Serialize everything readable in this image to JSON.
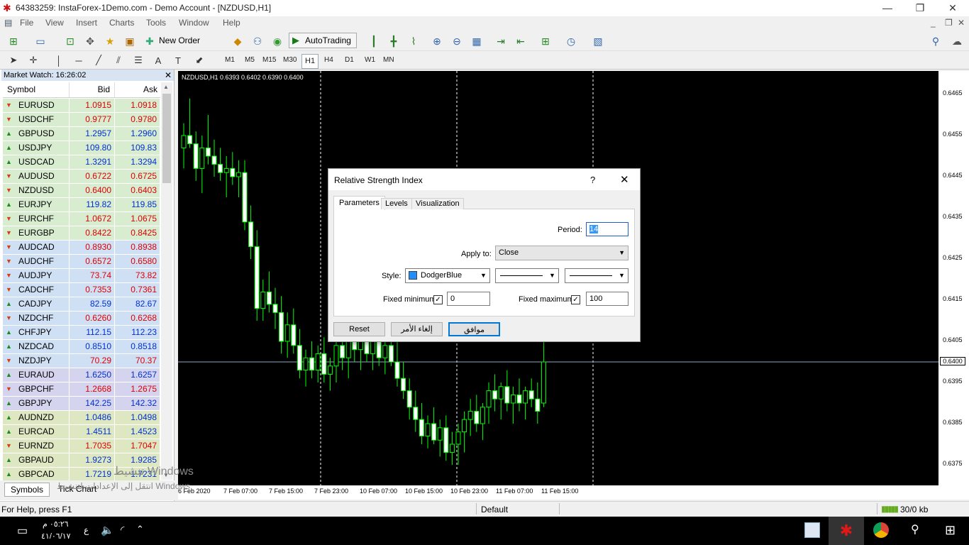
{
  "window": {
    "title": "64383259: InstaForex-1Demo.com - Demo Account - [NZDUSD,H1]",
    "minimize": "—",
    "restore": "❐",
    "close": "✕"
  },
  "menu": {
    "items": [
      "File",
      "View",
      "Insert",
      "Charts",
      "Tools",
      "Window",
      "Help"
    ]
  },
  "toolbar": {
    "new_order": "New Order",
    "autotrading": "AutoTrading"
  },
  "timeframes": [
    "M1",
    "M5",
    "M15",
    "M30",
    "H1",
    "H4",
    "D1",
    "W1",
    "MN"
  ],
  "selected_timeframe": "H1",
  "market_watch": {
    "title": "Market Watch: 16:26:02",
    "columns": [
      "Symbol",
      "Bid",
      "Ask"
    ],
    "rows": [
      {
        "symbol": "EURUSD",
        "bid": "1.0915",
        "ask": "1.0918",
        "dir": "dn",
        "bidc": "red",
        "askc": "red",
        "bg": "#d8ecd0"
      },
      {
        "symbol": "USDCHF",
        "bid": "0.9777",
        "ask": "0.9780",
        "dir": "dn",
        "bidc": "red",
        "askc": "red",
        "bg": "#d8ecd0"
      },
      {
        "symbol": "GBPUSD",
        "bid": "1.2957",
        "ask": "1.2960",
        "dir": "up",
        "bidc": "blue",
        "askc": "blue",
        "bg": "#d8ecd0"
      },
      {
        "symbol": "USDJPY",
        "bid": "109.80",
        "ask": "109.83",
        "dir": "up",
        "bidc": "blue",
        "askc": "blue",
        "bg": "#d8ecd0"
      },
      {
        "symbol": "USDCAD",
        "bid": "1.3291",
        "ask": "1.3294",
        "dir": "up",
        "bidc": "blue",
        "askc": "blue",
        "bg": "#d8ecd0"
      },
      {
        "symbol": "AUDUSD",
        "bid": "0.6722",
        "ask": "0.6725",
        "dir": "dn",
        "bidc": "red",
        "askc": "red",
        "bg": "#d8ecd0"
      },
      {
        "symbol": "NZDUSD",
        "bid": "0.6400",
        "ask": "0.6403",
        "dir": "dn",
        "bidc": "red",
        "askc": "red",
        "bg": "#d8ecd0"
      },
      {
        "symbol": "EURJPY",
        "bid": "119.82",
        "ask": "119.85",
        "dir": "up",
        "bidc": "blue",
        "askc": "blue",
        "bg": "#d8ecd0"
      },
      {
        "symbol": "EURCHF",
        "bid": "1.0672",
        "ask": "1.0675",
        "dir": "dn",
        "bidc": "red",
        "askc": "red",
        "bg": "#d8ecd0"
      },
      {
        "symbol": "EURGBP",
        "bid": "0.8422",
        "ask": "0.8425",
        "dir": "dn",
        "bidc": "red",
        "askc": "red",
        "bg": "#d8ecd0"
      },
      {
        "symbol": "AUDCAD",
        "bid": "0.8930",
        "ask": "0.8938",
        "dir": "dn",
        "bidc": "red",
        "askc": "red",
        "bg": "#cfe0f5"
      },
      {
        "symbol": "AUDCHF",
        "bid": "0.6572",
        "ask": "0.6580",
        "dir": "dn",
        "bidc": "red",
        "askc": "red",
        "bg": "#cfe0f5"
      },
      {
        "symbol": "AUDJPY",
        "bid": "73.74",
        "ask": "73.82",
        "dir": "dn",
        "bidc": "red",
        "askc": "red",
        "bg": "#cfe0f5"
      },
      {
        "symbol": "CADCHF",
        "bid": "0.7353",
        "ask": "0.7361",
        "dir": "dn",
        "bidc": "red",
        "askc": "red",
        "bg": "#cfe0f5"
      },
      {
        "symbol": "CADJPY",
        "bid": "82.59",
        "ask": "82.67",
        "dir": "up",
        "bidc": "blue",
        "askc": "blue",
        "bg": "#cfe0f5"
      },
      {
        "symbol": "NZDCHF",
        "bid": "0.6260",
        "ask": "0.6268",
        "dir": "dn",
        "bidc": "red",
        "askc": "red",
        "bg": "#cfe0f5"
      },
      {
        "symbol": "CHFJPY",
        "bid": "112.15",
        "ask": "112.23",
        "dir": "up",
        "bidc": "blue",
        "askc": "blue",
        "bg": "#cfe0f5"
      },
      {
        "symbol": "NZDCAD",
        "bid": "0.8510",
        "ask": "0.8518",
        "dir": "up",
        "bidc": "blue",
        "askc": "blue",
        "bg": "#cfe0f5"
      },
      {
        "symbol": "NZDJPY",
        "bid": "70.29",
        "ask": "70.37",
        "dir": "dn",
        "bidc": "red",
        "askc": "red",
        "bg": "#cfe0f5"
      },
      {
        "symbol": "EURAUD",
        "bid": "1.6250",
        "ask": "1.6257",
        "dir": "up",
        "bidc": "blue",
        "askc": "blue",
        "bg": "#d4d4ee"
      },
      {
        "symbol": "GBPCHF",
        "bid": "1.2668",
        "ask": "1.2675",
        "dir": "dn",
        "bidc": "red",
        "askc": "red",
        "bg": "#d4d4ee"
      },
      {
        "symbol": "GBPJPY",
        "bid": "142.25",
        "ask": "142.32",
        "dir": "up",
        "bidc": "blue",
        "askc": "blue",
        "bg": "#d4d4ee"
      },
      {
        "symbol": "AUDNZD",
        "bid": "1.0486",
        "ask": "1.0498",
        "dir": "up",
        "bidc": "blue",
        "askc": "blue",
        "bg": "#dde8c2"
      },
      {
        "symbol": "EURCAD",
        "bid": "1.4511",
        "ask": "1.4523",
        "dir": "up",
        "bidc": "blue",
        "askc": "blue",
        "bg": "#dde8c2"
      },
      {
        "symbol": "EURNZD",
        "bid": "1.7035",
        "ask": "1.7047",
        "dir": "dn",
        "bidc": "red",
        "askc": "red",
        "bg": "#dde8c2"
      },
      {
        "symbol": "GBPAUD",
        "bid": "1.9273",
        "ask": "1.9285",
        "dir": "up",
        "bidc": "blue",
        "askc": "blue",
        "bg": "#dde8c2"
      },
      {
        "symbol": "GBPCAD",
        "bid": "1.7219",
        "ask": "1.7231",
        "dir": "up",
        "bidc": "blue",
        "askc": "blue",
        "bg": "#dde8c2"
      }
    ],
    "tabs": [
      "Symbols",
      "Tick Chart"
    ]
  },
  "chart": {
    "info": "NZDUSD,H1  0.6393 0.6402 0.6390 0.6400",
    "price_labels": [
      "0.6465",
      "0.6455",
      "0.6445",
      "0.6435",
      "0.6425",
      "0.6415",
      "0.6405",
      "0.6395",
      "0.6385",
      "0.6375"
    ],
    "current_price": "0.6400",
    "time_labels": [
      "6 Feb 2020",
      "7 Feb 07:00",
      "7 Feb 15:00",
      "7 Feb 23:00",
      "10 Feb 07:00",
      "10 Feb 15:00",
      "10 Feb 23:00",
      "11 Feb 07:00",
      "11 Feb 15:00"
    ],
    "candles": [
      [
        0.6452,
        0.6458,
        0.6447,
        0.6455
      ],
      [
        0.6455,
        0.6464,
        0.6452,
        0.6453
      ],
      [
        0.6453,
        0.6456,
        0.6444,
        0.6447
      ],
      [
        0.6447,
        0.6455,
        0.6441,
        0.6452
      ],
      [
        0.6452,
        0.646,
        0.6448,
        0.645
      ],
      [
        0.645,
        0.6454,
        0.6445,
        0.6448
      ],
      [
        0.6448,
        0.6452,
        0.6444,
        0.6446
      ],
      [
        0.6446,
        0.645,
        0.644,
        0.6447
      ],
      [
        0.6447,
        0.6451,
        0.6443,
        0.6445
      ],
      [
        0.6445,
        0.6449,
        0.644,
        0.6446
      ],
      [
        0.6446,
        0.6449,
        0.6432,
        0.6434
      ],
      [
        0.6434,
        0.6438,
        0.6425,
        0.6428
      ],
      [
        0.6428,
        0.6432,
        0.641,
        0.6413
      ],
      [
        0.6413,
        0.642,
        0.641,
        0.6417
      ],
      [
        0.6417,
        0.6422,
        0.6412,
        0.6414
      ],
      [
        0.6414,
        0.6418,
        0.6408,
        0.6412
      ],
      [
        0.6412,
        0.6416,
        0.6402,
        0.6405
      ],
      [
        0.6405,
        0.6412,
        0.6401,
        0.6409
      ],
      [
        0.6409,
        0.6413,
        0.6402,
        0.6404
      ],
      [
        0.6404,
        0.6408,
        0.6396,
        0.6398
      ],
      [
        0.6398,
        0.6403,
        0.6394,
        0.6401
      ],
      [
        0.6401,
        0.6405,
        0.6396,
        0.6398
      ],
      [
        0.6398,
        0.6404,
        0.6395,
        0.6402
      ],
      [
        0.6402,
        0.6406,
        0.6395,
        0.6397
      ],
      [
        0.6397,
        0.6401,
        0.6393,
        0.6399
      ],
      [
        0.6399,
        0.6406,
        0.6395,
        0.6404
      ],
      [
        0.6404,
        0.6408,
        0.6398,
        0.6401
      ],
      [
        0.6401,
        0.6407,
        0.6396,
        0.6405
      ],
      [
        0.6405,
        0.6409,
        0.64,
        0.6403
      ],
      [
        0.6403,
        0.6408,
        0.6398,
        0.6406
      ],
      [
        0.6406,
        0.641,
        0.64,
        0.6402
      ],
      [
        0.6402,
        0.6407,
        0.6398,
        0.6405
      ],
      [
        0.6405,
        0.6408,
        0.6399,
        0.6401
      ],
      [
        0.6401,
        0.6406,
        0.6397,
        0.6404
      ],
      [
        0.6404,
        0.6408,
        0.6399,
        0.64
      ],
      [
        0.64,
        0.6405,
        0.6394,
        0.6396
      ],
      [
        0.6396,
        0.64,
        0.6391,
        0.6393
      ],
      [
        0.6393,
        0.6396,
        0.6386,
        0.6389
      ],
      [
        0.6389,
        0.6393,
        0.6383,
        0.6386
      ],
      [
        0.6386,
        0.639,
        0.638,
        0.6382
      ],
      [
        0.6382,
        0.6387,
        0.6379,
        0.6385
      ],
      [
        0.6385,
        0.6389,
        0.638,
        0.6381
      ],
      [
        0.6381,
        0.6386,
        0.6377,
        0.6384
      ],
      [
        0.6384,
        0.6387,
        0.6376,
        0.6378
      ],
      [
        0.6378,
        0.6383,
        0.6375,
        0.638
      ],
      [
        0.638,
        0.6385,
        0.6375,
        0.6383
      ],
      [
        0.6383,
        0.6388,
        0.6378,
        0.6386
      ],
      [
        0.6386,
        0.6391,
        0.6382,
        0.6388
      ],
      [
        0.6388,
        0.6392,
        0.6383,
        0.6385
      ],
      [
        0.6385,
        0.639,
        0.6381,
        0.6389
      ],
      [
        0.6389,
        0.6395,
        0.6385,
        0.6393
      ],
      [
        0.6393,
        0.6397,
        0.6388,
        0.6391
      ],
      [
        0.6391,
        0.6395,
        0.6386,
        0.6394
      ],
      [
        0.6394,
        0.6398,
        0.6388,
        0.639
      ],
      [
        0.639,
        0.6394,
        0.6385,
        0.6392
      ],
      [
        0.6392,
        0.6396,
        0.6388,
        0.639
      ],
      [
        0.639,
        0.6394,
        0.6386,
        0.6393
      ],
      [
        0.6393,
        0.6396,
        0.6389,
        0.6391
      ],
      [
        0.6391,
        0.6395,
        0.6385,
        0.6388
      ],
      [
        0.639,
        0.6405,
        0.6389,
        0.64
      ]
    ]
  },
  "dialog": {
    "title": "Relative Strength Index",
    "help": "?",
    "close": "✕",
    "tabs": [
      "Parameters",
      "Levels",
      "Visualization"
    ],
    "period_label": "Period:",
    "period_value": "14",
    "apply_label": "Apply to:",
    "apply_value": "Close",
    "style_label": "Style:",
    "style_color": "DodgerBlue",
    "style_color_hex": "#1e90ff",
    "fixed_min_label": "Fixed minimum",
    "fixed_min_value": "0",
    "fixed_max_label": "Fixed maximum",
    "fixed_max_value": "100",
    "reset": "Reset",
    "cancel": "إلغاء الأمر",
    "ok": "موافق"
  },
  "status": {
    "help": "For Help, press F1",
    "profile": "Default",
    "traffic": "30/0 kb"
  },
  "watermark": {
    "line1": "تنشيط Windows",
    "line2": "انتقل إلى الإعدادات لتنشيط Windows."
  },
  "taskbar": {
    "time": "٠٥:٢٦ م",
    "date": "٤١/٠٦/١٧",
    "lang": "ع"
  }
}
